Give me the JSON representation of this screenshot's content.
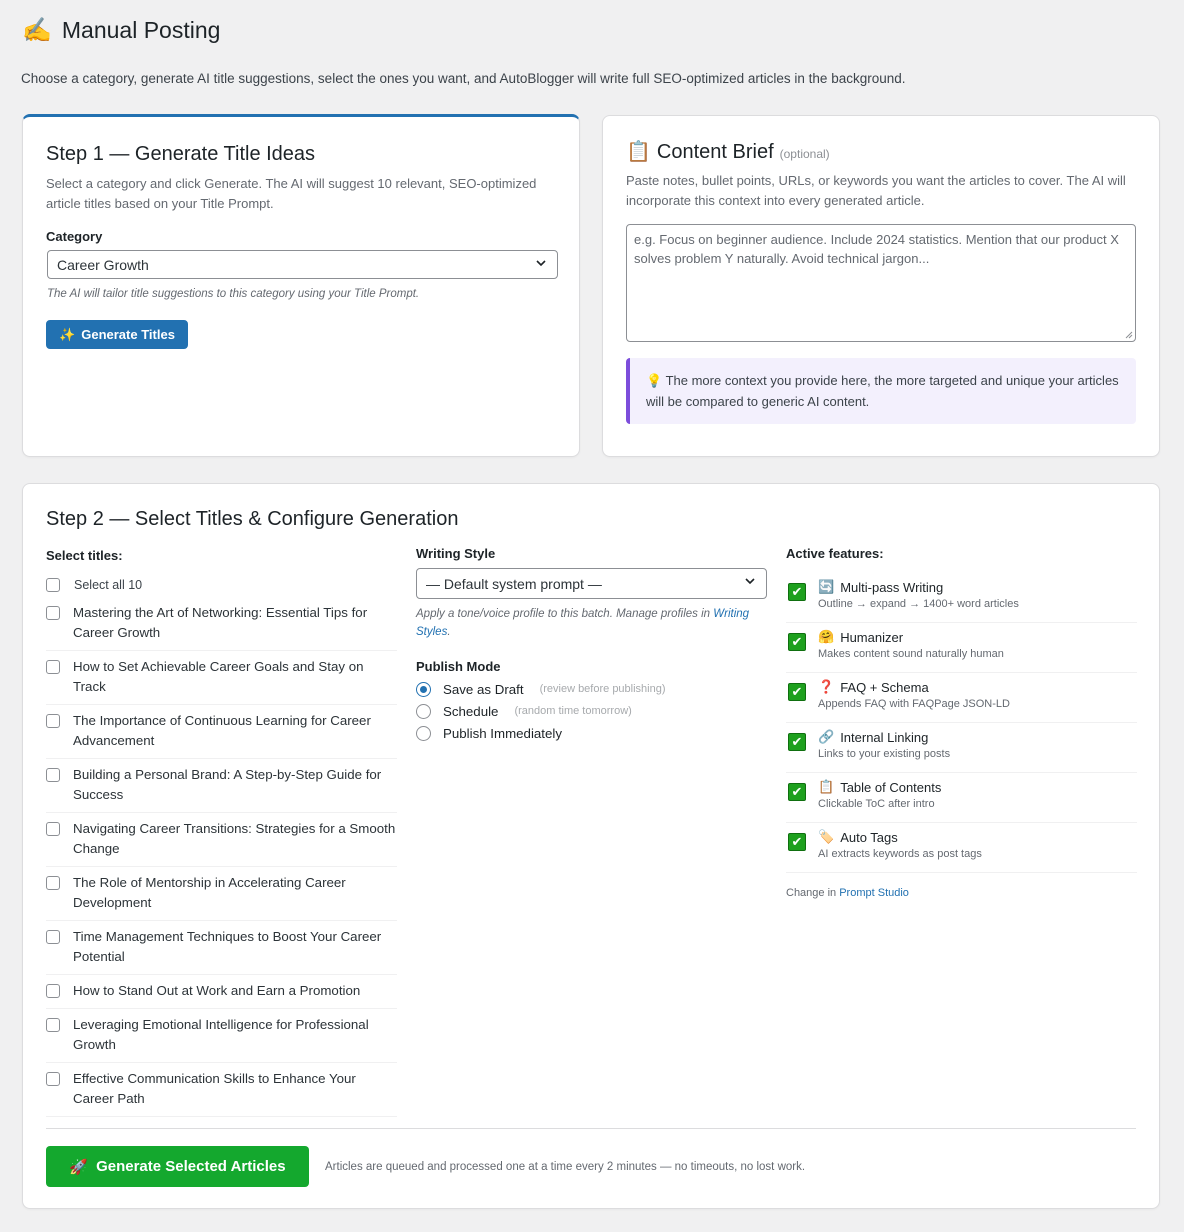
{
  "page": {
    "title_emoji": "✍️",
    "title": "Manual Posting",
    "intro": "Choose a category, generate AI title suggestions, select the ones you want, and AutoBlogger will write full SEO-optimized articles in the background."
  },
  "step1": {
    "title": "Step 1 — Generate Title Ideas",
    "description": "Select a category and click Generate. The AI will suggest 10 relevant, SEO-optimized article titles based on your Title Prompt.",
    "category_label": "Category",
    "category_value": "Career Growth",
    "category_hint": "The AI will tailor title suggestions to this category using your Title Prompt.",
    "generate_icon": "✨",
    "generate_label": "Generate Titles"
  },
  "brief": {
    "icon": "📋",
    "title": "Content Brief",
    "optional": "(optional)",
    "description": "Paste notes, bullet points, URLs, or keywords you want the articles to cover. The AI will incorporate this context into every generated article.",
    "placeholder": "e.g. Focus on beginner audience. Include 2024 statistics. Mention that our product X solves problem Y naturally. Avoid technical jargon...",
    "tip_icon": "💡",
    "tip": "The more context you provide here, the more targeted and unique your articles will be compared to generic AI content."
  },
  "step2": {
    "title": "Step 2 — Select Titles & Configure Generation",
    "select_titles_label": "Select titles:",
    "select_all_label": "Select all 10",
    "titles": [
      "Mastering the Art of Networking: Essential Tips for Career Growth",
      "How to Set Achievable Career Goals and Stay on Track",
      "The Importance of Continuous Learning for Career Advancement",
      "Building a Personal Brand: A Step-by-Step Guide for Success",
      "Navigating Career Transitions: Strategies for a Smooth Change",
      "The Role of Mentorship in Accelerating Career Development",
      "Time Management Techniques to Boost Your Career Potential",
      "How to Stand Out at Work and Earn a Promotion",
      "Leveraging Emotional Intelligence for Professional Growth",
      "Effective Communication Skills to Enhance Your Career Path"
    ],
    "writing_style_label": "Writing Style",
    "writing_style_value": "— Default system prompt —",
    "writing_style_hint_pre": "Apply a tone/voice profile to this batch. Manage profiles in ",
    "writing_style_hint_link": "Writing Styles",
    "writing_style_hint_post": ".",
    "publish_mode_label": "Publish Mode",
    "publish_modes": [
      {
        "label": "Save as Draft",
        "sub": "(review before publishing)",
        "selected": true
      },
      {
        "label": "Schedule",
        "sub": "(random time tomorrow)",
        "selected": false
      },
      {
        "label": "Publish Immediately",
        "sub": "",
        "selected": false
      }
    ],
    "active_features_label": "Active features:",
    "features": [
      {
        "icon": "🔄",
        "name": "Multi-pass Writing",
        "sub": "Outline → expand → 1400+ word articles"
      },
      {
        "icon": "🤗",
        "name": "Humanizer",
        "sub": "Makes content sound naturally human"
      },
      {
        "icon": "❓",
        "name": "FAQ + Schema",
        "sub": "Appends FAQ with FAQPage JSON-LD"
      },
      {
        "icon": "🔗",
        "name": "Internal Linking",
        "sub": "Links to your existing posts"
      },
      {
        "icon": "📋",
        "name": "Table of Contents",
        "sub": "Clickable ToC after intro"
      },
      {
        "icon": "🏷️",
        "name": "Auto Tags",
        "sub": "AI extracts keywords as post tags"
      }
    ],
    "change_in_pre": "Change in ",
    "change_in_link": "Prompt Studio",
    "check_glyph": "✔",
    "generate_icon": "🚀",
    "generate_label": "Generate Selected Articles",
    "queue_note": "Articles are queued and processed one at a time every 2 minutes — no timeouts, no lost work."
  }
}
